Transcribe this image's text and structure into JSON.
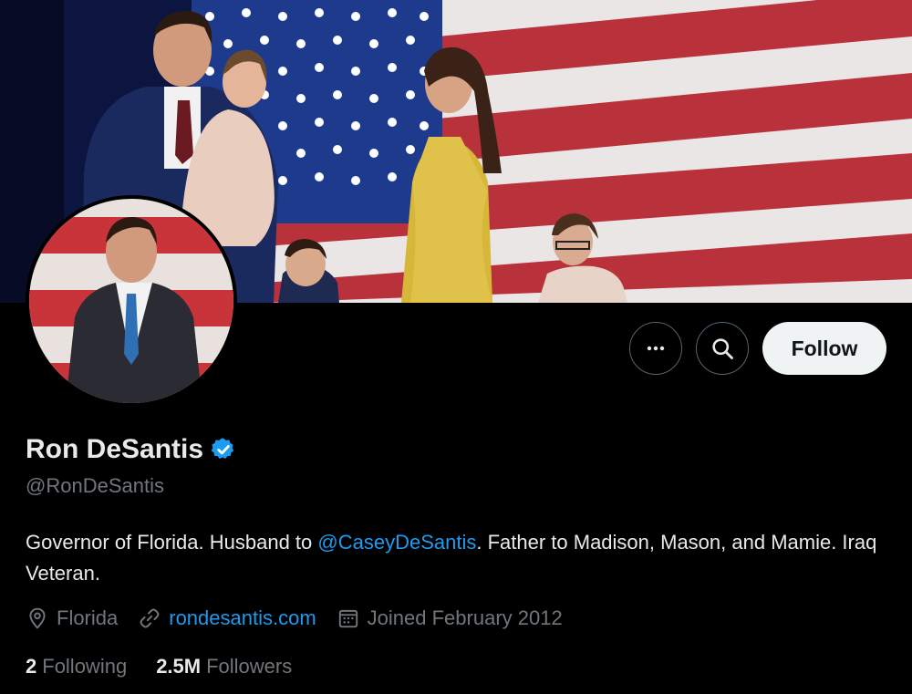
{
  "profile": {
    "name": "Ron DeSantis",
    "handle": "@RonDeSantis",
    "verified": true,
    "bio_before": "Governor of Florida. Husband to ",
    "bio_mention": "@CaseyDeSantis",
    "bio_after": ". Father to Madison, Mason, and Mamie. Iraq Veteran.",
    "location": "Florida",
    "website": "rondesantis.com",
    "joined": "Joined February 2012"
  },
  "stats": {
    "following_count": "2",
    "following_label": "Following",
    "followers_count": "2.5M",
    "followers_label": "Followers"
  },
  "actions": {
    "follow_label": "Follow"
  },
  "icons": {
    "more": "more-options-icon",
    "search": "search-icon",
    "verified": "verified-badge-icon",
    "location": "location-pin-icon",
    "link": "link-icon",
    "calendar": "calendar-icon"
  },
  "colors": {
    "accent": "#1d9bf0",
    "background": "#000000",
    "muted": "#71767b",
    "follow_bg": "#eff3f4"
  }
}
